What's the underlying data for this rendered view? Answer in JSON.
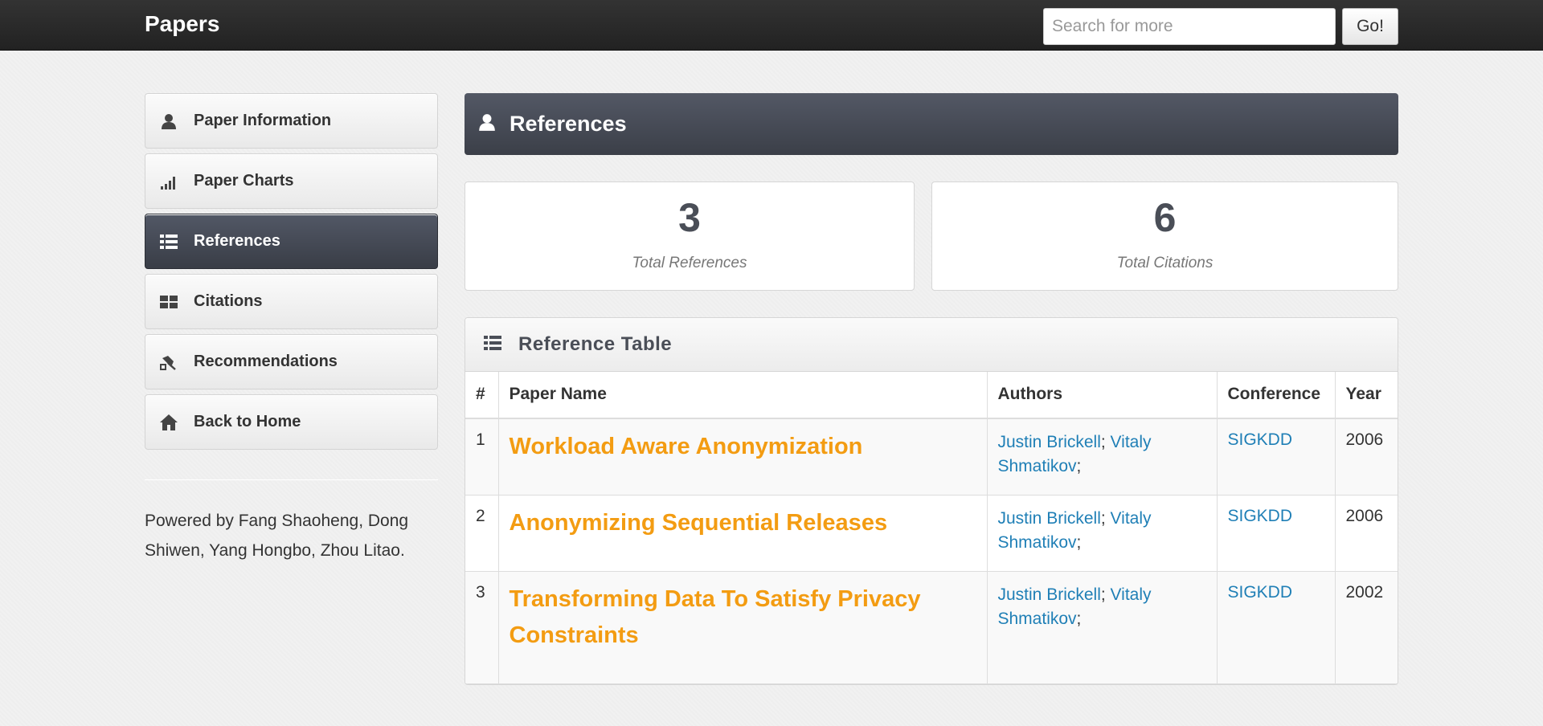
{
  "navbar": {
    "brand": "Papers",
    "search_placeholder": "Search for more",
    "go_label": "Go!"
  },
  "sidebar": {
    "items": [
      {
        "label": "Paper Information",
        "icon": "user-icon"
      },
      {
        "label": "Paper Charts",
        "icon": "signal-bars-icon"
      },
      {
        "label": "References",
        "icon": "list-icon",
        "active": true
      },
      {
        "label": "Citations",
        "icon": "grid-icon"
      },
      {
        "label": "Recommendations",
        "icon": "satellite-icon"
      },
      {
        "label": "Back to Home",
        "icon": "home-icon"
      }
    ],
    "footer": "Powered by Fang Shaoheng, Dong Shiwen, Yang Hongbo, Zhou Litao."
  },
  "main": {
    "header_title": "References",
    "stats": [
      {
        "value": "3",
        "caption": "Total References"
      },
      {
        "value": "6",
        "caption": "Total Citations"
      }
    ],
    "table": {
      "title": "Reference Table",
      "columns": [
        "#",
        "Paper Name",
        "Authors",
        "Conference",
        "Year"
      ],
      "rows": [
        {
          "num": "1",
          "paper": "Workload Aware Anonymization",
          "author1": "Justin Brickell",
          "author2": "Vitaly Shmatikov",
          "conference": "SIGKDD",
          "year": "2006"
        },
        {
          "num": "2",
          "paper": "Anonymizing Sequential Releases",
          "author1": "Justin Brickell",
          "author2": "Vitaly Shmatikov",
          "conference": "SIGKDD",
          "year": "2006"
        },
        {
          "num": "3",
          "paper": "Transforming Data To Satisfy Privacy Constraints",
          "author1": "Justin Brickell",
          "author2": "Vitaly Shmatikov",
          "conference": "SIGKDD",
          "year": "2002"
        }
      ]
    }
  },
  "colors": {
    "accent_orange": "#f39c12",
    "link_blue": "#1f7fb6",
    "active_dark": "#3b3f48"
  }
}
